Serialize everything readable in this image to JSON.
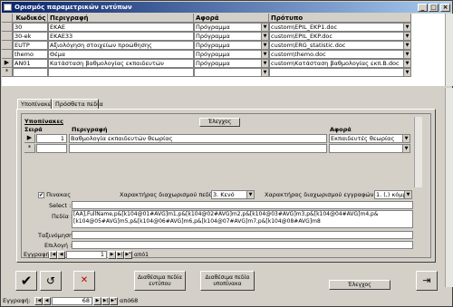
{
  "window": {
    "title": "Ορισμός παραμετρικών εντύπων",
    "minimize": "_",
    "maximize": "□",
    "close": "×"
  },
  "grid": {
    "headers": [
      "Κωδικός",
      "Περιγραφή",
      "Αφορά",
      "Πρότυπο"
    ],
    "rows": [
      {
        "code": "30",
        "desc": "ΕΚΑΕ",
        "concerns": "Πρόγραμμα",
        "template": "custom\\EPIL_EKP1.doc",
        "marker": ""
      },
      {
        "code": "30-ek",
        "desc": "ΕΚΑΕ33",
        "concerns": "Πρόγραμμα",
        "template": "custom\\EPIL_EKP.doc",
        "marker": ""
      },
      {
        "code": "EUTP",
        "desc": "Αξιολόγηση στοιχείων προώθησης",
        "concerns": "Πρόγραμμα",
        "template": "custom\\ERG_statistic.doc",
        "marker": ""
      },
      {
        "code": "themo",
        "desc": "Θέμα",
        "concerns": "Πρόγραμμα",
        "template": "custom\\themo.doc",
        "marker": ""
      },
      {
        "code": "ΑΝ01",
        "desc": "Κατάσταση βαθμολογίας εκπαιδευτών",
        "concerns": "Πρόγραμμα",
        "template": "custom\\Κατάσταση βαθμολογίας εκπ.Β.doc",
        "marker": "▶"
      },
      {
        "code": "",
        "desc": "",
        "concerns": "",
        "template": "",
        "marker": "*"
      }
    ]
  },
  "tabs": [
    "Υποπίνακες",
    "Πρόσθετα πεδία"
  ],
  "subform": {
    "title": "Υποπίνακες",
    "check_button": "Έλεγχος",
    "headers": [
      "Σειρά",
      "Περιγραφή",
      "Αφορά"
    ],
    "rows": [
      {
        "order": "1",
        "desc": "Βαθμολογία εκπαιδευτών θεωρίας",
        "concerns": "Εκπαιδευτές θεωρίας",
        "marker": "▶"
      },
      {
        "order": "",
        "desc": "",
        "concerns": "",
        "marker": "*"
      }
    ],
    "table_checkbox": "Πινακας",
    "field_sep_label": "Χαρακτήρας διαχωρισμού πεδίων :",
    "field_sep_value": "3. Κενό",
    "record_sep_label": "Χαρακτήρας διαχωρισμού εγγραφών :",
    "record_sep_value": "1. (,) κόμμ",
    "select_label": "Select :",
    "fields_label": "Πεδία :",
    "fields_value": "[AA],FullName,p&[k104@01#AVG]m1,p&[k104@02#AVG]m2,p&[k104@03#AVG]m3,p&[k104@04#AVG]m4,p&[k104@05#AVG]m5,p&[k104@06#AVG]m6,p&[k104@07#AVG]m7,p&[k104@08#AVG]m8",
    "sort_label": "Ταξινόμηση :",
    "filter_label": "Επιλογή :",
    "nav_label": "Εγγραφή:",
    "nav_current": "1",
    "nav_of": "από",
    "nav_total": "1"
  },
  "bottom": {
    "avail_form_fields": "Διαθέσιμα πεδία εντύπου",
    "avail_sub_fields": "Διαθέσιμα πεδία υποπίνακα",
    "check_button": "Έλεγχος",
    "nav_label": "Εγγραφή:",
    "nav_current": "68",
    "nav_of": "από",
    "nav_total": "68"
  }
}
